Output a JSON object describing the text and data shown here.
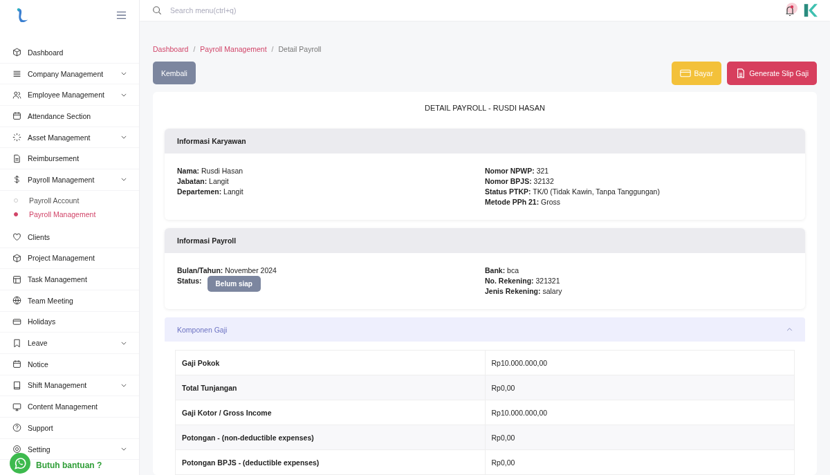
{
  "search": {
    "placeholder": "Search menu(ctrl+q)"
  },
  "sidebar": {
    "items": [
      {
        "label": "Dashboard",
        "has_submenu": false
      },
      {
        "label": "Company Management",
        "has_submenu": true
      },
      {
        "label": "Employee Management",
        "has_submenu": true
      },
      {
        "label": "Attendance Section",
        "has_submenu": false
      },
      {
        "label": "Asset Management",
        "has_submenu": true
      },
      {
        "label": "Reimbursement",
        "has_submenu": false
      },
      {
        "label": "Payroll Management",
        "has_submenu": true,
        "children": [
          {
            "label": "Payroll Account",
            "selected": false
          },
          {
            "label": "Payroll Management",
            "selected": true
          }
        ]
      },
      {
        "label": "Clients",
        "has_submenu": false
      },
      {
        "label": "Project Management",
        "has_submenu": false
      },
      {
        "label": "Task Management",
        "has_submenu": false
      },
      {
        "label": "Team Meeting",
        "has_submenu": false
      },
      {
        "label": "Holidays",
        "has_submenu": false
      },
      {
        "label": "Leave",
        "has_submenu": true
      },
      {
        "label": "Notice",
        "has_submenu": false
      },
      {
        "label": "Shift Management",
        "has_submenu": true
      },
      {
        "label": "Content Management",
        "has_submenu": false
      },
      {
        "label": "Support",
        "has_submenu": false
      },
      {
        "label": "Setting",
        "has_submenu": true
      }
    ]
  },
  "help_widget": {
    "label": "Butuh bantuan ?"
  },
  "breadcrumb_separator": "/",
  "breadcrumb": [
    {
      "label": "Dashboard",
      "current": false
    },
    {
      "label": "Payroll Management",
      "current": false
    },
    {
      "label": "Detail Payroll",
      "current": true
    }
  ],
  "buttons": {
    "back": "Kembali",
    "pay": "Bayar",
    "generate": "Generate Slip Gaji"
  },
  "card_title": "DETAIL PAYROLL - RUSDI HASAN",
  "sections": [
    {
      "title": "Informasi Karyawan",
      "left": [
        {
          "label": "Nama:",
          "value": "Rusdi Hasan"
        },
        {
          "label": "Jabatan:",
          "value": "Langit"
        },
        {
          "label": "Departemen:",
          "value": "Langit"
        }
      ],
      "right": [
        {
          "label": "Nomor NPWP:",
          "value": "321"
        },
        {
          "label": "Nomor BPJS:",
          "value": "32132"
        },
        {
          "label": "Status PTKP:",
          "value": "TK/0 (Tidak Kawin, Tanpa Tanggungan)"
        },
        {
          "label": "Metode PPh 21:",
          "value": "Gross"
        }
      ]
    },
    {
      "title": "Informasi Payroll",
      "left": [
        {
          "label": "Bulan/Tahun:",
          "value": "November 2024"
        },
        {
          "label": "Status:",
          "badge": "Belum siap"
        }
      ],
      "right": [
        {
          "label": "Bank:",
          "value": "bca"
        },
        {
          "label": "No. Rekening:",
          "value": "321321"
        },
        {
          "label": "Jenis Rekening:",
          "value": "salary"
        }
      ]
    }
  ],
  "components": {
    "title": "Komponen Gaji",
    "expanded": true,
    "rows": [
      {
        "name": "Gaji Pokok",
        "amount": "Rp10.000.000,00"
      },
      {
        "name": "Total Tunjangan",
        "amount": "Rp0,00"
      },
      {
        "name": "Gaji Kotor / Gross Income",
        "amount": "Rp10.000.000,00"
      },
      {
        "name": "Potongan - (non-deductible expenses)",
        "amount": "Rp0,00"
      },
      {
        "name": "Potongan BPJS - (deductible expenses)",
        "amount": "Rp0,00"
      }
    ]
  }
}
